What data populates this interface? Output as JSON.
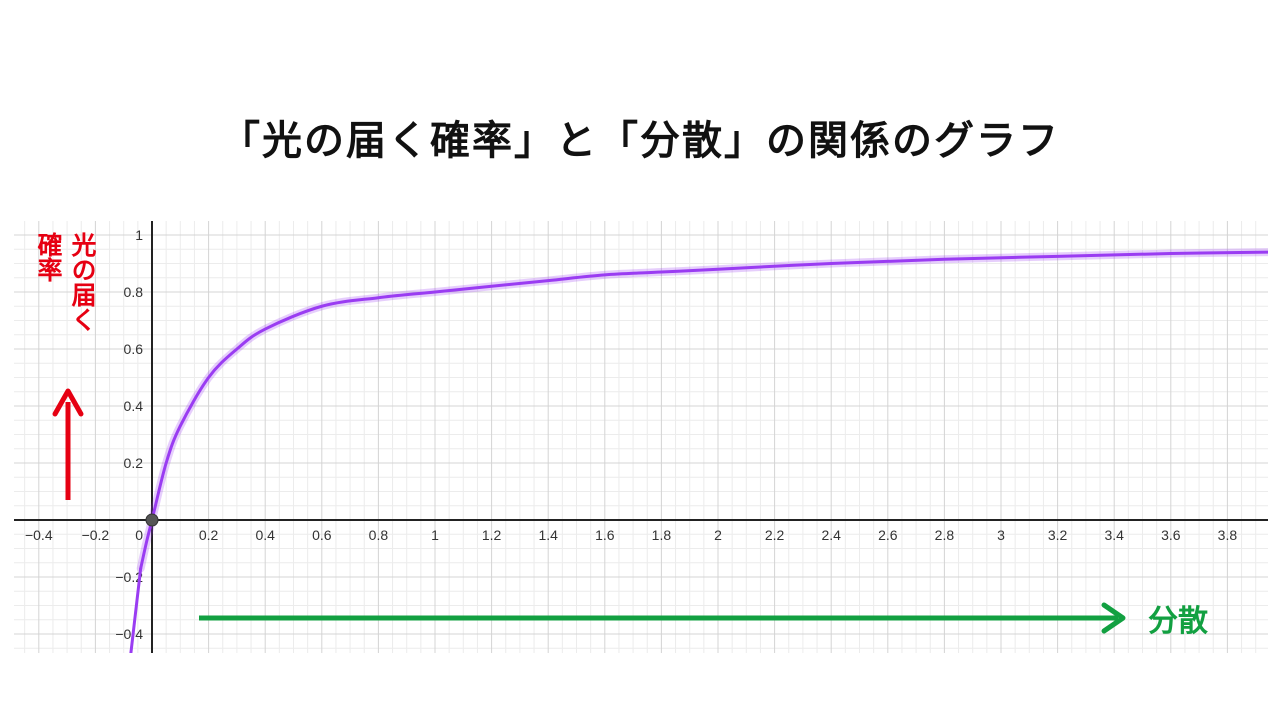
{
  "title": "「光の届く確率」と「分散」の関係のグラフ",
  "colors": {
    "curve": "#9a3cf2",
    "y_annotation": "#e60012",
    "x_annotation": "#12a041",
    "grid_major": "#d4d4d4",
    "grid_minor": "#ececec",
    "axis": "#222222"
  },
  "annotations": {
    "y_label_column_1": "光の届く",
    "y_label_column_2": "確率",
    "x_label": "分散"
  },
  "chart_data": {
    "type": "line",
    "title": "「光の届く確率」と「分散」の関係のグラフ",
    "xlabel": "分散",
    "ylabel": "光の届く確率",
    "xlim": [
      -0.5,
      3.95
    ],
    "ylim": [
      -0.47,
      1.06
    ],
    "grid": true,
    "x_ticks": [
      {
        "value": -0.4,
        "label": "−0.4"
      },
      {
        "value": -0.2,
        "label": "−0.2"
      },
      {
        "value": 0.2,
        "label": "0.2"
      },
      {
        "value": 0.4,
        "label": "0.4"
      },
      {
        "value": 0.6,
        "label": "0.6"
      },
      {
        "value": 0.8,
        "label": "0.8"
      },
      {
        "value": 1,
        "label": "1"
      },
      {
        "value": 1.2,
        "label": "1.2"
      },
      {
        "value": 1.4,
        "label": "1.4"
      },
      {
        "value": 1.6,
        "label": "1.6"
      },
      {
        "value": 1.8,
        "label": "1.8"
      },
      {
        "value": 2,
        "label": "2"
      },
      {
        "value": 2.2,
        "label": "2.2"
      },
      {
        "value": 2.4,
        "label": "2.4"
      },
      {
        "value": 2.6,
        "label": "2.6"
      },
      {
        "value": 2.8,
        "label": "2.8"
      },
      {
        "value": 3,
        "label": "3"
      },
      {
        "value": 3.2,
        "label": "3.2"
      },
      {
        "value": 3.4,
        "label": "3.4"
      },
      {
        "value": 3.6,
        "label": "3.6"
      },
      {
        "value": 3.8,
        "label": "3.8"
      }
    ],
    "y_ticks": [
      {
        "value": 1,
        "label": "1"
      },
      {
        "value": 0.8,
        "label": "0.8"
      },
      {
        "value": 0.6,
        "label": "0.6"
      },
      {
        "value": 0.4,
        "label": "0.4"
      },
      {
        "value": 0.2,
        "label": "0.2"
      },
      {
        "value": -0.2,
        "label": "−0.2"
      },
      {
        "value": -0.4,
        "label": "−0.4"
      }
    ],
    "origin_label": "0",
    "series": [
      {
        "x": [
          -0.04,
          -0.02,
          0,
          0.05,
          0.1,
          0.2,
          0.3,
          0.4,
          0.6,
          0.8,
          1,
          1.2,
          1.4,
          1.6,
          1.8,
          2,
          2.4,
          2.8,
          3.2,
          3.6,
          3.95
        ],
        "y": [
          -0.17,
          -0.08,
          0,
          0.2,
          0.33,
          0.5,
          0.6,
          0.67,
          0.75,
          0.78,
          0.8,
          0.82,
          0.84,
          0.86,
          0.87,
          0.88,
          0.9,
          0.915,
          0.925,
          0.935,
          0.94
        ]
      }
    ],
    "points": [
      {
        "x": 0,
        "y": 0
      }
    ]
  }
}
